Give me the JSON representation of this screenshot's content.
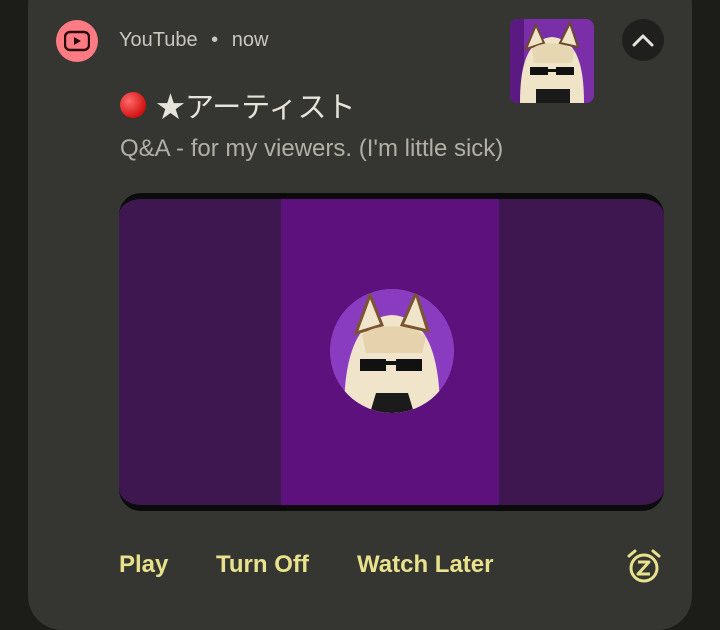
{
  "notification": {
    "app_name": "YouTube",
    "separator": "•",
    "time": "now",
    "title_icon": "red-circle-icon",
    "title": "★アーティスト",
    "subtitle": "Q&A - for my viewers. (I'm little sick)",
    "expand_icon": "chevron-up-icon"
  },
  "actions": {
    "play_label": "Play",
    "turn_off_label": "Turn Off",
    "watch_later_label": "Watch Later",
    "snooze_icon": "snooze-alarm-icon"
  },
  "colors": {
    "card_bg": "#353531",
    "app_icon": "#ff7b84",
    "action_text": "#e9e28c",
    "image_purple": "#5c117c",
    "image_dark_purple": "#3e1650"
  }
}
